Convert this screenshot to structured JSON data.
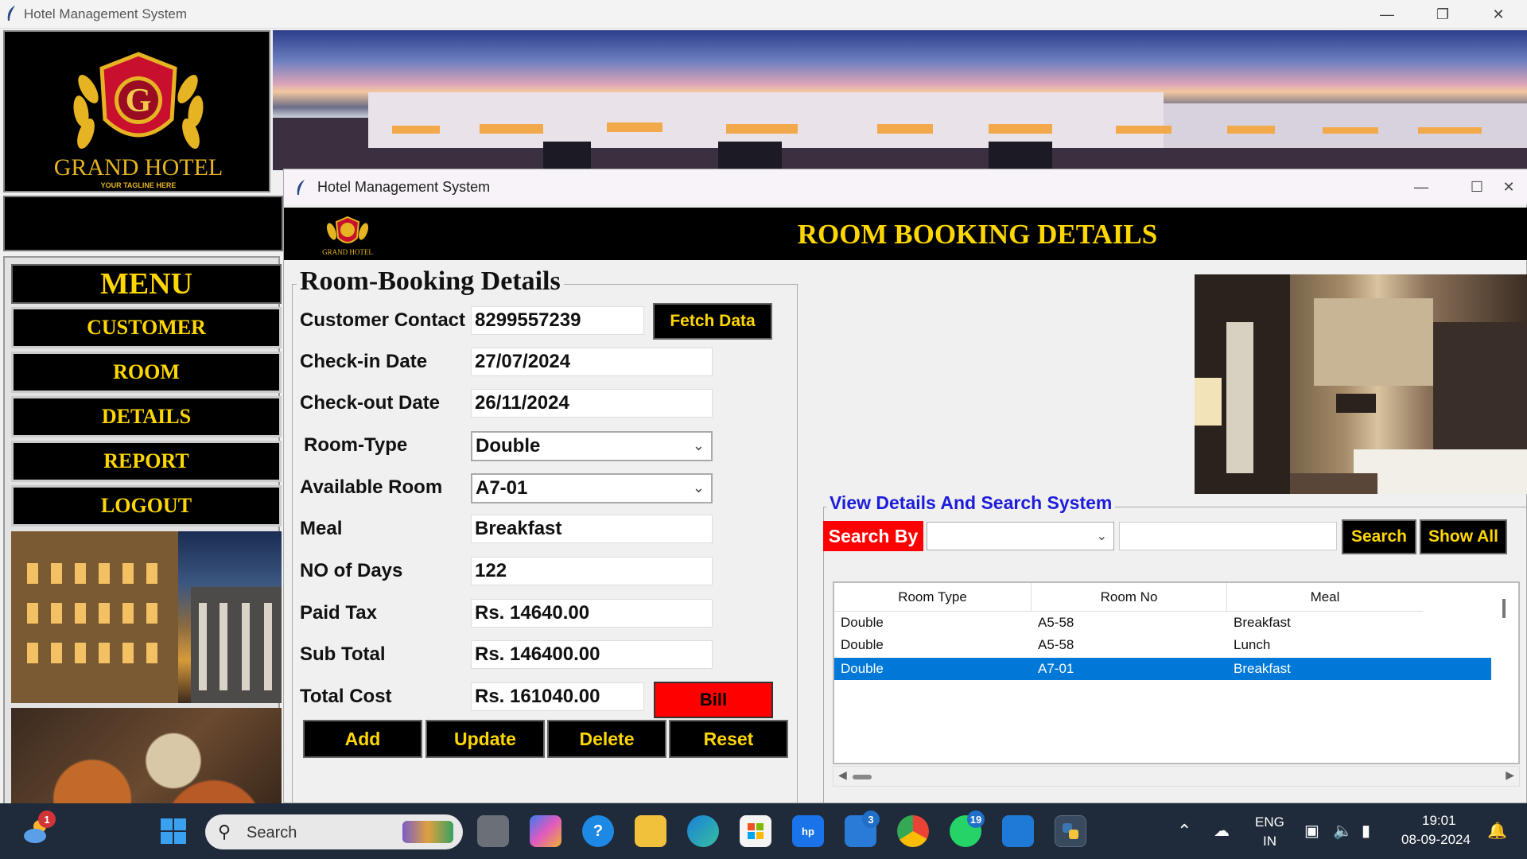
{
  "main_window": {
    "title": "Hotel Management System",
    "logo_text": "GRAND HOTEL",
    "logo_tagline": "YOUR TAGLINE HERE",
    "logo_letter": "G"
  },
  "menu": {
    "title": "MENU",
    "items": [
      "CUSTOMER",
      "ROOM",
      "DETAILS",
      "REPORT",
      "LOGOUT"
    ]
  },
  "child_window": {
    "title": "Hotel Management System",
    "header_title": "ROOM BOOKING DETAILS",
    "small_logo_text": "GRAND HOTEL"
  },
  "form": {
    "legend": "Room-Booking Details",
    "customer_contact_label": "Customer Contact",
    "customer_contact_value": "8299557239",
    "fetch_button": "Fetch Data",
    "checkin_label": "Check-in Date",
    "checkin_value": "27/07/2024",
    "checkout_label": "Check-out Date",
    "checkout_value": "26/11/2024",
    "room_type_label": "Room-Type",
    "room_type_value": "Double",
    "available_room_label": "Available Room",
    "available_room_value": "A7-01",
    "meal_label": "Meal",
    "meal_value": "Breakfast",
    "days_label": "NO of Days",
    "days_value": "122",
    "paid_tax_label": "Paid Tax",
    "paid_tax_value": "Rs. 14640.00",
    "sub_total_label": "Sub Total",
    "sub_total_value": "Rs. 146400.00",
    "total_cost_label": "Total Cost",
    "total_cost_value": "Rs. 161040.00",
    "bill_button": "Bill",
    "buttons": {
      "add": "Add",
      "update": "Update",
      "delete": "Delete",
      "reset": "Reset"
    }
  },
  "search": {
    "legend": "View Details And Search System",
    "search_by_label": "Search By",
    "search_button": "Search",
    "show_all_button": "Show All",
    "columns": [
      "Room Type",
      "Room No",
      "Meal"
    ],
    "rows": [
      [
        "Double",
        "A5-58",
        "Breakfast"
      ],
      [
        "Double",
        "A5-58",
        "Lunch"
      ],
      [
        "Double",
        "A7-01",
        "Breakfast"
      ]
    ],
    "selected_row": 2
  },
  "taskbar": {
    "search_placeholder": "Search",
    "weather_badge": "1",
    "mail_badge": "3",
    "whatsapp_badge": "19",
    "language": "ENG",
    "region": "IN",
    "time": "19:01",
    "date": "08-09-2024"
  },
  "colors": {
    "gold": "#ffd700",
    "black": "#000000",
    "red": "#ff0000",
    "link_blue": "#1c1cdc",
    "selection": "#0078d7"
  }
}
